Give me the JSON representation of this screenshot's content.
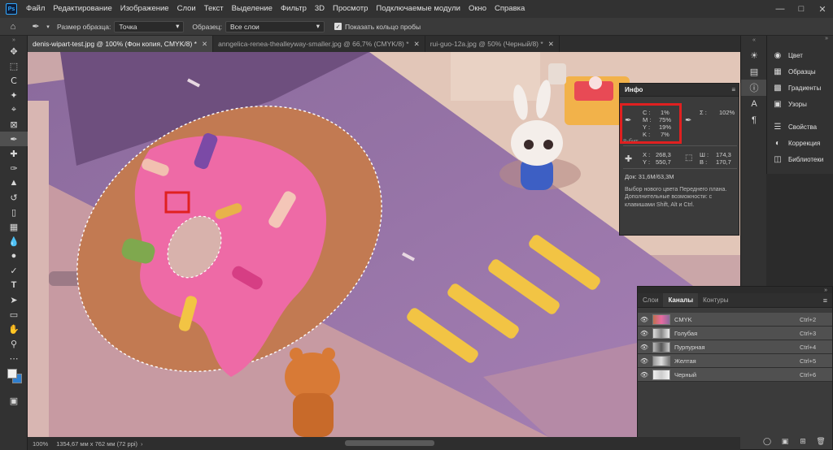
{
  "app": {
    "logo": "Ps"
  },
  "menu": [
    "Файл",
    "Редактирование",
    "Изображение",
    "Слои",
    "Текст",
    "Выделение",
    "Фильтр",
    "3D",
    "Просмотр",
    "Подключаемые модули",
    "Окно",
    "Справка"
  ],
  "window_controls": [
    "minimize-icon",
    "maximize-icon",
    "close-icon"
  ],
  "options": {
    "sample_size_label": "Размер образца:",
    "sample_size_value": "Точка",
    "sample_label": "Образец:",
    "sample_value": "Все слои",
    "show_ring_label": "Показать кольцо пробы",
    "show_ring_checked": true
  },
  "tabs": [
    {
      "label": "denis-wipart-test.jpg @ 100% (Фон копия, CMYK/8) *",
      "active": true
    },
    {
      "label": "anngelica-renea-thealleyway-smaller.jpg @ 66,7% (CMYK/8) *",
      "active": false
    },
    {
      "label": "rui-guo-12a.jpg @ 50% (Черный/8) *",
      "active": false
    }
  ],
  "tools": [
    "move-tool",
    "marquee-tool",
    "lasso-tool",
    "quick-select-tool",
    "crop-tool",
    "frame-tool",
    "eyedropper-tool",
    "healing-tool",
    "brush-tool",
    "clone-stamp-tool",
    "history-brush-tool",
    "eraser-tool",
    "gradient-tool",
    "blur-tool",
    "dodge-tool",
    "pen-tool",
    "type-tool",
    "path-select-tool",
    "rectangle-tool",
    "hand-tool",
    "zoom-tool",
    "more-tools"
  ],
  "colors": {
    "foreground": "#f0f0f0",
    "background": "#2f7fd0",
    "highlight_box": "#e02020"
  },
  "info_panel": {
    "title": "Инфо",
    "c_label": "C :",
    "c_value": "1%",
    "m_label": "M :",
    "m_value": "75%",
    "y_label": "Y :",
    "y_value": "19%",
    "k_label": "K :",
    "k_value": "7%",
    "bit_depth": "8-бит",
    "sigma_label": "Σ :",
    "sigma_value": "102%",
    "x_label": "X :",
    "x_value": "268,3",
    "y2_label": "Y :",
    "y2_value": "550,7",
    "w_label": "Ш :",
    "w_value": "174,3",
    "h_label": "В :",
    "h_value": "170,7",
    "doc": "Док: 31,6M/63,3M",
    "description": "Выбор нового цвета Переднего плана. Дополнительные возможности: с клавишами Shift, Alt и Ctrl."
  },
  "right_dock": [
    {
      "label": "Цвет",
      "icon": "color-icon"
    },
    {
      "label": "Образцы",
      "icon": "swatches-icon"
    },
    {
      "label": "Градиенты",
      "icon": "gradients-icon"
    },
    {
      "label": "Узоры",
      "icon": "patterns-icon"
    },
    {
      "label": "Свойства",
      "icon": "properties-icon"
    },
    {
      "label": "Коррекция",
      "icon": "adjustments-icon"
    },
    {
      "label": "Библиотеки",
      "icon": "libraries-icon"
    }
  ],
  "layers_panel": {
    "tabs": [
      "Слои",
      "Каналы",
      "Контуры"
    ],
    "active_tab": "Каналы",
    "channels": [
      {
        "name": "CMYK",
        "key": "Ctrl+2"
      },
      {
        "name": "Голубая",
        "key": "Ctrl+3"
      },
      {
        "name": "Пурпурная",
        "key": "Ctrl+4"
      },
      {
        "name": "Желтая",
        "key": "Ctrl+5"
      },
      {
        "name": "Черный",
        "key": "Ctrl+6"
      }
    ]
  },
  "status": {
    "zoom": "100%",
    "dimensions": "1354,67 мм x 762 мм (72 ppi)"
  }
}
